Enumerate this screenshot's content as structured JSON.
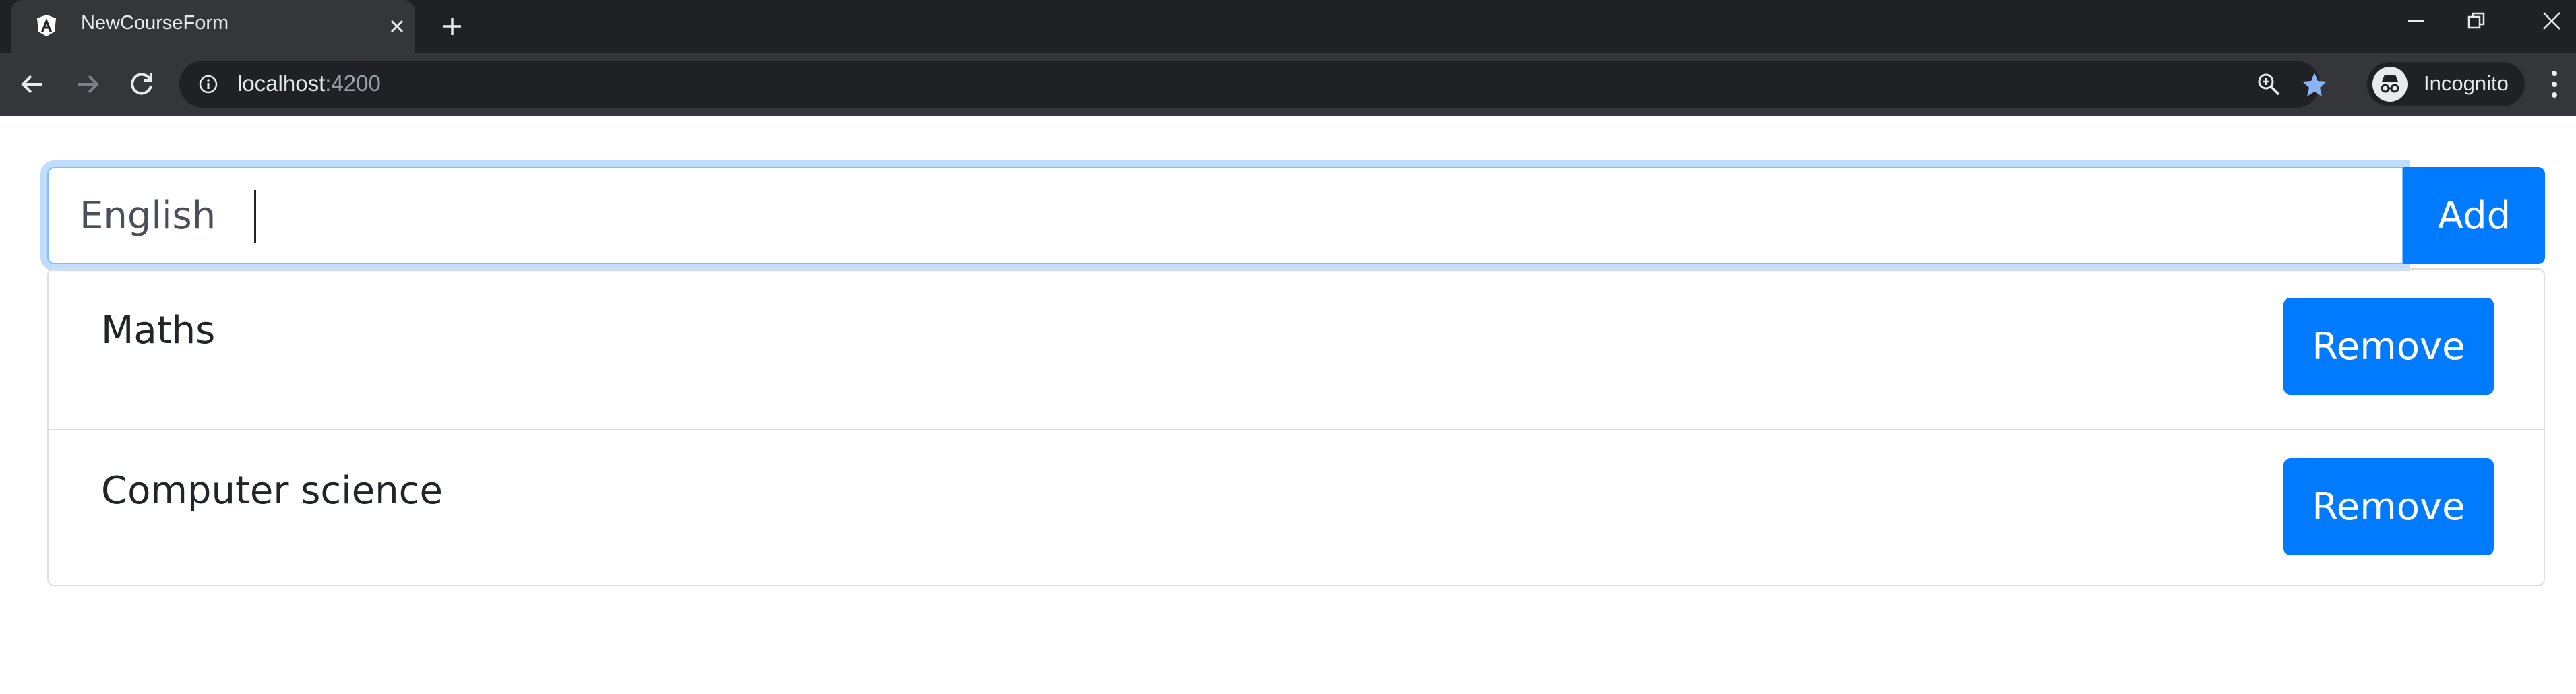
{
  "browser": {
    "tab": {
      "title": "NewCourseForm"
    },
    "address": {
      "host": "localhost",
      "port": ":4200"
    },
    "profile": {
      "label": "Incognito"
    },
    "colors": {
      "chrome_dark": "#202124",
      "chrome_tab": "#35363a",
      "bookmark_star": "#8ab4f8"
    }
  },
  "form": {
    "input_value": "English",
    "add_label": "Add"
  },
  "courses": [
    {
      "name": "Maths",
      "remove_label": "Remove"
    },
    {
      "name": "Computer science",
      "remove_label": "Remove"
    }
  ],
  "colors": {
    "primary": "#007bff",
    "focus_border": "#80bdff",
    "text": "#212529"
  }
}
